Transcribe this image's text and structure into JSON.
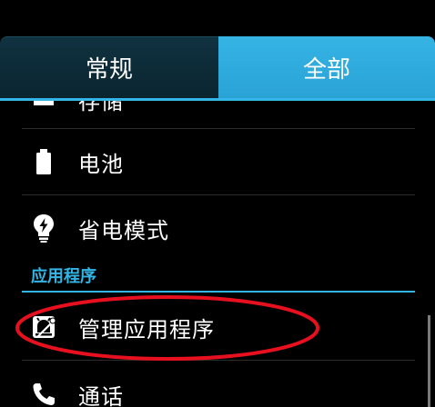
{
  "tabs": {
    "general": "常规",
    "all": "全部"
  },
  "list": {
    "storage_partial": "存储",
    "battery": "电池",
    "power_saving": "省电模式",
    "section_apps": "应用程序",
    "manage_apps": "管理应用程序",
    "calls": "通话"
  },
  "colors": {
    "accent": "#33b5e5",
    "tab_active": "#35b4e4",
    "tab_inactive": "#0a2530",
    "highlight": "#e8101e"
  },
  "icons": {
    "storage": "storage-icon",
    "battery": "battery-icon",
    "power_saving": "lightbulb-bolt-icon",
    "manage_apps": "app-manager-icon",
    "calls": "phone-icon"
  }
}
